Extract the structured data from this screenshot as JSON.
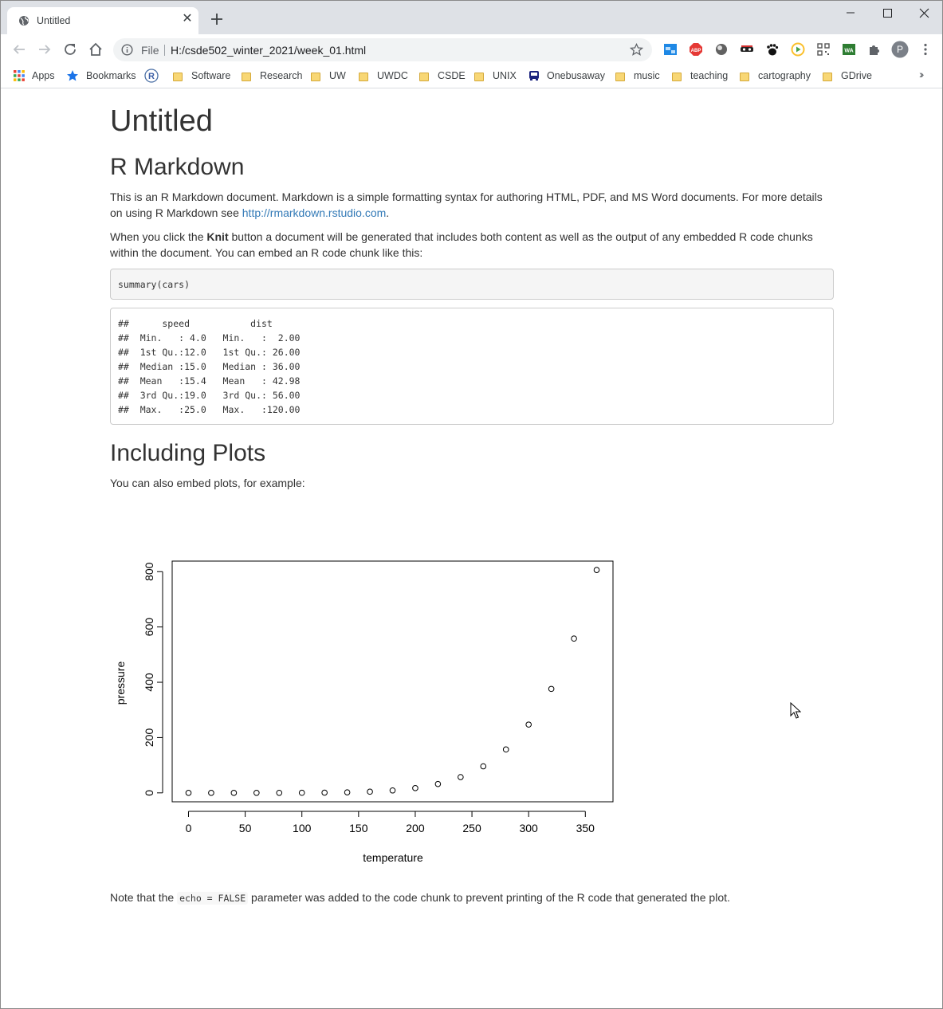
{
  "browser": {
    "tab_title": "Untitled",
    "address_scheme": "File",
    "address_url": "H:/csde502_winter_2021/week_01.html",
    "profile_initial": "P",
    "bookmarks": [
      {
        "label": "Apps",
        "icon": "apps-grid-icon"
      },
      {
        "label": "Bookmarks",
        "icon": "star-icon"
      },
      {
        "label": "",
        "icon": "r-logo-icon"
      },
      {
        "label": "Software",
        "icon": "folder-icon"
      },
      {
        "label": "Research",
        "icon": "folder-icon"
      },
      {
        "label": "UW",
        "icon": "folder-icon"
      },
      {
        "label": "UWDC",
        "icon": "folder-icon"
      },
      {
        "label": "CSDE",
        "icon": "folder-icon"
      },
      {
        "label": "UNIX",
        "icon": "folder-icon"
      },
      {
        "label": "Onebusaway",
        "icon": "bus-icon"
      },
      {
        "label": "music",
        "icon": "folder-icon"
      },
      {
        "label": "teaching",
        "icon": "folder-icon"
      },
      {
        "label": "cartography",
        "icon": "folder-icon"
      },
      {
        "label": "GDrive",
        "icon": "folder-icon"
      }
    ],
    "colors": {
      "tabstrip": "#dee1e6",
      "link": "#337ab7"
    }
  },
  "document": {
    "title": "Untitled",
    "h2_rmarkdown": "R Markdown",
    "p1_text": "This is an R Markdown document. Markdown is a simple formatting syntax for authoring HTML, PDF, and MS Word documents. For more details on using R Markdown see ",
    "p1_link": "http://rmarkdown.rstudio.com",
    "p1_end": ".",
    "p2_before": "When you click the ",
    "p2_bold": "Knit",
    "p2_after": " button a document will be generated that includes both content as well as the output of any embedded R code chunks within the document. You can embed an R code chunk like this:",
    "code_source": "summary(cars)",
    "code_output": "##      speed           dist       \n##  Min.   : 4.0   Min.   :  2.00  \n##  1st Qu.:12.0   1st Qu.: 26.00  \n##  Median :15.0   Median : 36.00  \n##  Mean   :15.4   Mean   : 42.98  \n##  3rd Qu.:19.0   3rd Qu.: 56.00  \n##  Max.   :25.0   Max.   :120.00  ",
    "h2_plots": "Including Plots",
    "p3_text": "You can also embed plots, for example:",
    "note_before": "Note that the ",
    "note_code": "echo = FALSE",
    "note_after": " parameter was added to the code chunk to prevent printing of the R code that generated the plot."
  },
  "chart_data": {
    "type": "scatter",
    "xlabel": "temperature",
    "ylabel": "pressure",
    "x": [
      0,
      20,
      40,
      60,
      80,
      100,
      120,
      140,
      160,
      180,
      200,
      220,
      240,
      260,
      280,
      300,
      320,
      340,
      360
    ],
    "y": [
      0.0002,
      0.0012,
      0.006,
      0.03,
      0.09,
      0.27,
      0.75,
      1.85,
      4.2,
      8.8,
      17.3,
      32.1,
      57,
      96,
      157,
      247,
      376,
      558,
      806
    ],
    "xticks": [
      "0",
      "50",
      "100",
      "150",
      "200",
      "250",
      "300",
      "350"
    ],
    "xtick_values": [
      0,
      50,
      100,
      150,
      200,
      250,
      300,
      350
    ],
    "yticks": [
      "0",
      "200",
      "400",
      "600",
      "800"
    ],
    "ytick_values": [
      0,
      200,
      400,
      600,
      800
    ],
    "xlim": [
      -14.4,
      374.4
    ],
    "ylim": [
      -32.24,
      838.24
    ],
    "grid": false,
    "marker": "open-circle"
  }
}
